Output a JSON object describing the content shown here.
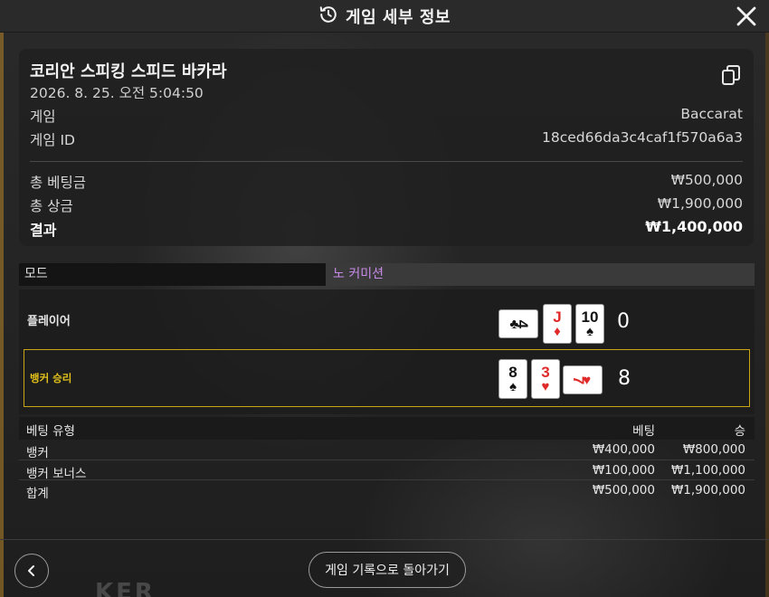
{
  "header": {
    "title": "게임 세부 정보",
    "history_icon": "history-icon",
    "close_icon": "close-icon"
  },
  "summary": {
    "game_title": "코리안 스피킹 스피드 바카라",
    "datetime": "2026. 8. 25. 오전 5:04:50",
    "game_label": "게임",
    "game_value": "Baccarat",
    "game_id_label": "게임 ID",
    "game_id_value": "18ced66da3c4caf1f570a6a3",
    "total_bet_label": "총 베팅금",
    "total_bet_value": "₩500,000",
    "total_win_label": "총 상금",
    "total_win_value": "₩1,900,000",
    "result_label": "결과",
    "result_value": "₩1,400,000",
    "copy_icon": "copy-icon"
  },
  "mode": {
    "label": "모드",
    "value": "노 커미션"
  },
  "hands": {
    "player": {
      "label": "플레이어",
      "score": "0",
      "cards": [
        {
          "rank": "4",
          "suit": "♣",
          "color": "black",
          "orientation": "horizontal"
        },
        {
          "rank": "J",
          "suit": "♦",
          "color": "red",
          "orientation": "vertical"
        },
        {
          "rank": "10",
          "suit": "♠",
          "color": "black",
          "orientation": "vertical"
        }
      ]
    },
    "banker": {
      "label": "뱅커 승리",
      "score": "8",
      "cards": [
        {
          "rank": "8",
          "suit": "♠",
          "color": "black",
          "orientation": "vertical"
        },
        {
          "rank": "3",
          "suit": "♥",
          "color": "red",
          "orientation": "vertical"
        },
        {
          "rank": "7",
          "suit": "♥",
          "color": "red",
          "orientation": "horizontal"
        }
      ]
    }
  },
  "bets": {
    "headers": {
      "type": "베팅 유형",
      "bet": "베팅",
      "win": "승"
    },
    "rows": [
      {
        "type": "뱅커",
        "bet": "₩400,000",
        "win": "₩800,000"
      },
      {
        "type": "뱅커 보너스",
        "bet": "₩100,000",
        "win": "₩1,100,000"
      },
      {
        "type": "합계",
        "bet": "₩500,000",
        "win": "₩1,900,000"
      }
    ]
  },
  "footer": {
    "back_label": "게임 기록으로 돌아가기",
    "back_icon": "chevron-left-icon"
  },
  "colors": {
    "banker_highlight": "#c9a516",
    "mode_value": "#c98be8",
    "card_red": "#e02a2a"
  }
}
